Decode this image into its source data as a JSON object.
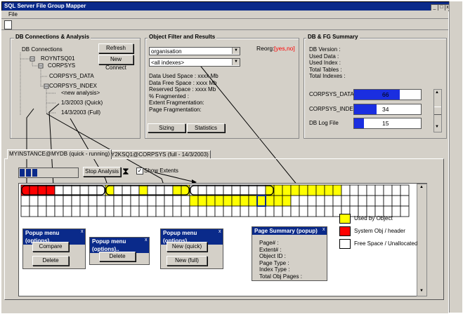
{
  "window": {
    "title": "SQL Server File Group Mapper",
    "min_glyph": "_",
    "max_glyph": "□",
    "close_glyph": "x"
  },
  "menu": {
    "file": "File"
  },
  "db_panel": {
    "title": "DB Connections & Analysis",
    "refresh": "Refresh",
    "new_connect": "New Connect",
    "tree": {
      "root": "DB Connections",
      "server": "ROYNTSQ01",
      "database": "CORPSYS",
      "data_file": "CORPSYS_DATA",
      "index_file": "CORPSYS_INDEX",
      "analysis_new": "<new analysis>",
      "analysis_1": "1/3/2003 (Quick)",
      "analysis_2": "14/3/2003 (Full)"
    }
  },
  "filter_panel": {
    "title": "Object Filter and Results",
    "object_value": "organisation",
    "index_value": "<all indexes>",
    "reorg_label": "Reorg:",
    "reorg_value": "[yes,no]",
    "stats": [
      "Data Used Space :  xxxx Mb",
      "Data Free Space :  xxxx Mb",
      "Reserved Space :  xxxx Mb",
      "% Fragmented :",
      "Extent Fragmentation:",
      "Page Fragmentation:"
    ],
    "sizing": "Sizing",
    "statistics": "Statistics"
  },
  "summary_panel": {
    "title": "DB & FG Summary",
    "fields": [
      "DB Version :",
      "Used Data :",
      "Used Index :",
      "Total Tables :",
      "Total Indexes :"
    ],
    "bars": [
      {
        "label": "CORPSYS_DATA",
        "value": "66",
        "fill_fraction": 0.68
      },
      {
        "label": "CORPSYS_INDEX",
        "value": "34",
        "fill_fraction": 0.34
      },
      {
        "label": "DB Log File",
        "value": "15",
        "fill_fraction": 0.15
      }
    ],
    "fill_color": "#1a2ee0"
  },
  "tabs": {
    "tab1": "MYINSTANCE@MYDB (quick - running)",
    "tab2": "ROY2KSQ1@CORPSYS (full - 14/3/2003)"
  },
  "analysis": {
    "stop": "Stop Analysis",
    "show_extents": "Show Extents",
    "show_extents_checked": true,
    "progress_glyph": "⧗"
  },
  "map": {
    "row1": "RRRRWWWWWWYWWWYWWWYYWWWWWWWWWYYYYYYYYYWWWWWWWW",
    "row2": "WWWWWWWWWWWWWWWWWWWWYYYYYYYYYYYYWWWWWWWWWWWWWW",
    "row3": "WWWWWWWWWWWWWWWWWWWWWWWWWWWWWWWWWWWWWWWWWWWWWW"
  },
  "colors": {
    "used": "#ffff00",
    "system": "#ff0000",
    "free": "#ffffff",
    "title_blue": "#0a2a8a",
    "reorg_red": "#ff0000"
  },
  "legend": {
    "used": "Used by Object",
    "system": "System Obj / header",
    "free": "Free Space / Unallocated"
  },
  "popups": {
    "p1": {
      "title": "Popup menu (options)..",
      "b1": "Compare",
      "b2": "Delete"
    },
    "p2": {
      "title": "Popup menu (options)..",
      "b1": "Delete"
    },
    "p3": {
      "title": "Popup menu (options)..",
      "b1": "New (quick)",
      "b2": "New (full)"
    },
    "p_close": "x"
  },
  "page_summary": {
    "title": "Page Summary (popup)",
    "fields": [
      "Page# :",
      "Extent# :",
      "Object ID :",
      "Page Type :",
      "Index Type :",
      "Total Obj Pages :"
    ]
  }
}
